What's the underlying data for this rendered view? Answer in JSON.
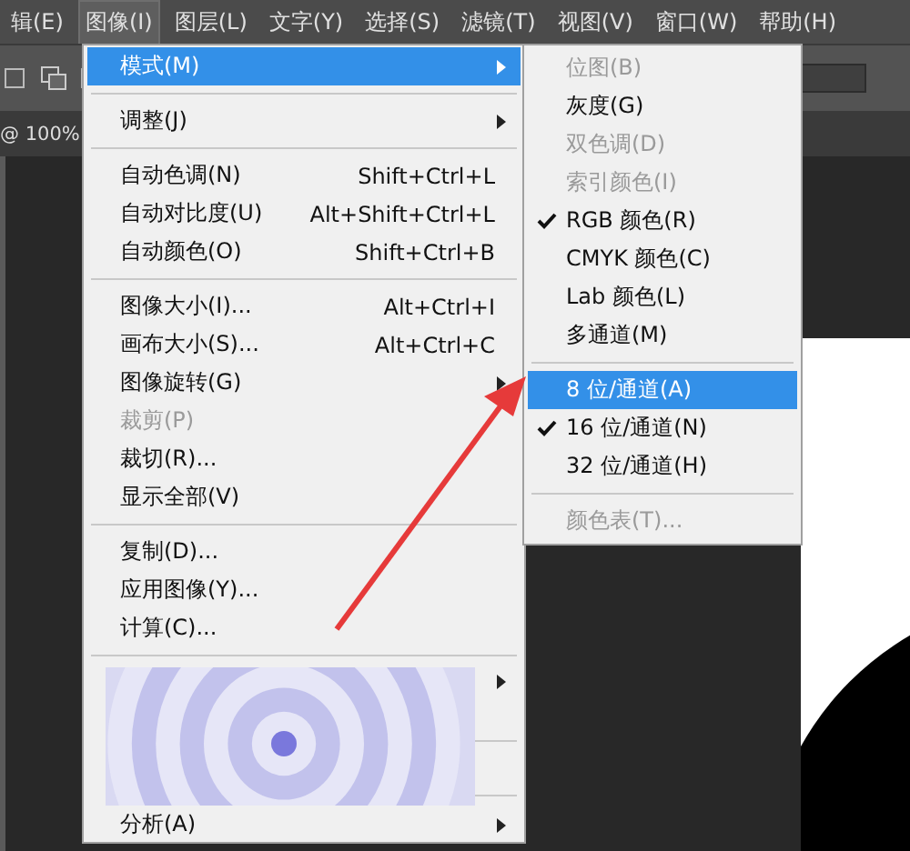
{
  "menubar": [
    {
      "label": "辑(E)",
      "selected": false
    },
    {
      "label": "图像(I)",
      "selected": true
    },
    {
      "label": "图层(L)",
      "selected": false
    },
    {
      "label": "文字(Y)",
      "selected": false
    },
    {
      "label": "选择(S)",
      "selected": false
    },
    {
      "label": "滤镜(T)",
      "selected": false
    },
    {
      "label": "视图(V)",
      "selected": false
    },
    {
      "label": "窗口(W)",
      "selected": false
    },
    {
      "label": "帮助(H)",
      "selected": false
    }
  ],
  "document_tab": "@ 100%",
  "image_menu": [
    {
      "kind": "item",
      "label": "模式(M)",
      "submenu": true,
      "selected": true,
      "disabled": false
    },
    {
      "kind": "separator"
    },
    {
      "kind": "item",
      "label": "调整(J)",
      "submenu": true,
      "selected": false,
      "disabled": false
    },
    {
      "kind": "separator"
    },
    {
      "kind": "item",
      "label": "自动色调(N)",
      "shortcut": "Shift+Ctrl+L",
      "submenu": false,
      "selected": false,
      "disabled": false
    },
    {
      "kind": "item",
      "label": "自动对比度(U)",
      "shortcut": "Alt+Shift+Ctrl+L",
      "submenu": false,
      "selected": false,
      "disabled": false
    },
    {
      "kind": "item",
      "label": "自动颜色(O)",
      "shortcut": "Shift+Ctrl+B",
      "submenu": false,
      "selected": false,
      "disabled": false
    },
    {
      "kind": "separator"
    },
    {
      "kind": "item",
      "label": "图像大小(I)...",
      "shortcut": "Alt+Ctrl+I",
      "submenu": false,
      "selected": false,
      "disabled": false
    },
    {
      "kind": "item",
      "label": "画布大小(S)...",
      "shortcut": "Alt+Ctrl+C",
      "submenu": false,
      "selected": false,
      "disabled": false
    },
    {
      "kind": "item",
      "label": "图像旋转(G)",
      "submenu": true,
      "selected": false,
      "disabled": false
    },
    {
      "kind": "item",
      "label": "裁剪(P)",
      "submenu": false,
      "selected": false,
      "disabled": true
    },
    {
      "kind": "item",
      "label": "裁切(R)...",
      "submenu": false,
      "selected": false,
      "disabled": false
    },
    {
      "kind": "item",
      "label": "显示全部(V)",
      "submenu": false,
      "selected": false,
      "disabled": false
    },
    {
      "kind": "separator"
    },
    {
      "kind": "item",
      "label": "复制(D)...",
      "submenu": false,
      "selected": false,
      "disabled": false
    },
    {
      "kind": "item",
      "label": "应用图像(Y)...",
      "submenu": false,
      "selected": false,
      "disabled": false
    },
    {
      "kind": "item",
      "label": "计算(C)...",
      "submenu": false,
      "selected": false,
      "disabled": false
    },
    {
      "kind": "separator"
    },
    {
      "kind": "picture",
      "submenu": true
    },
    {
      "kind": "item",
      "label": "分析(A)",
      "submenu": true,
      "selected": false,
      "disabled": false
    }
  ],
  "mode_submenu": [
    {
      "kind": "item",
      "label": "位图(B)",
      "checked": false,
      "selected": false,
      "disabled": true
    },
    {
      "kind": "item",
      "label": "灰度(G)",
      "checked": false,
      "selected": false,
      "disabled": false
    },
    {
      "kind": "item",
      "label": "双色调(D)",
      "checked": false,
      "selected": false,
      "disabled": true
    },
    {
      "kind": "item",
      "label": "索引颜色(I)",
      "checked": false,
      "selected": false,
      "disabled": true
    },
    {
      "kind": "item",
      "label": "RGB 颜色(R)",
      "checked": true,
      "selected": false,
      "disabled": false
    },
    {
      "kind": "item",
      "label": "CMYK 颜色(C)",
      "checked": false,
      "selected": false,
      "disabled": false
    },
    {
      "kind": "item",
      "label": "Lab 颜色(L)",
      "checked": false,
      "selected": false,
      "disabled": false
    },
    {
      "kind": "item",
      "label": "多通道(M)",
      "checked": false,
      "selected": false,
      "disabled": false
    },
    {
      "kind": "separator"
    },
    {
      "kind": "item",
      "label": "8 位/通道(A)",
      "checked": false,
      "selected": true,
      "disabled": false
    },
    {
      "kind": "item",
      "label": "16 位/通道(N)",
      "checked": true,
      "selected": false,
      "disabled": false
    },
    {
      "kind": "item",
      "label": "32 位/通道(H)",
      "checked": false,
      "selected": false,
      "disabled": false
    },
    {
      "kind": "separator"
    },
    {
      "kind": "item",
      "label": "颜色表(T)...",
      "checked": false,
      "selected": false,
      "disabled": true
    }
  ]
}
